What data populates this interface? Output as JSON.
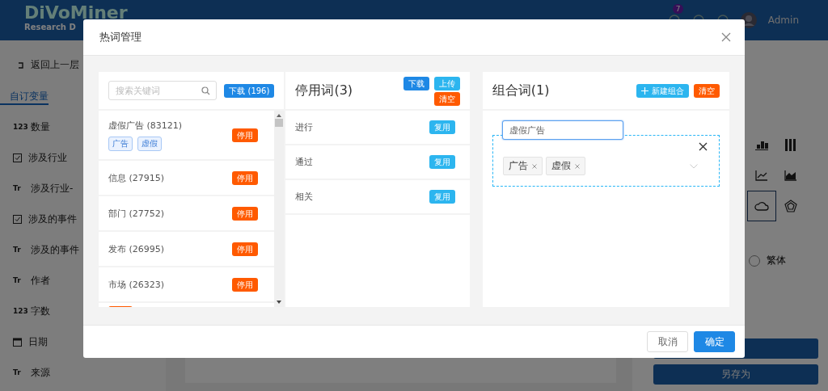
{
  "app": {
    "logo": "DiVoMiner",
    "logo_sub": "Research D",
    "notification_count": "7",
    "user": "Admin",
    "back": "返回上一层",
    "sidebar_tab": "自订变量",
    "variables": [
      {
        "kind": "number",
        "icon": "123",
        "label": "数量"
      },
      {
        "kind": "check",
        "label": "涉及行业"
      },
      {
        "kind": "text",
        "icon": "Tr",
        "label": "涉及行业-"
      },
      {
        "kind": "check",
        "label": "涉及的事件"
      },
      {
        "kind": "text",
        "icon": "Tr",
        "label": "涉及的事件"
      },
      {
        "kind": "text",
        "icon": "Tr",
        "label": "作者"
      },
      {
        "kind": "number",
        "icon": "123",
        "label": "字数"
      },
      {
        "kind": "date",
        "label": "日期"
      },
      {
        "kind": "text",
        "icon": "Tr",
        "label": "来源"
      }
    ],
    "chart_types": [
      {
        "kind": "stacked",
        "selected": false
      },
      {
        "kind": "columns",
        "selected": false
      },
      {
        "kind": "line",
        "selected": false
      },
      {
        "kind": "area",
        "selected": false
      },
      {
        "kind": "cloud",
        "selected": true
      },
      {
        "kind": "radar",
        "selected": false
      }
    ],
    "radio_option": {
      "label": "繁体",
      "selected": false
    },
    "save_as": "另存为"
  },
  "dialog": {
    "title": "热词管理",
    "hot_words": {
      "search": {
        "placeholder": "搜索关键词"
      },
      "download": "下载 (196)",
      "items": [
        {
          "word": "虚假广告 (83121)",
          "tags": [
            "广告",
            "虚假"
          ],
          "action": "停用"
        },
        {
          "word": "信息 (27915)",
          "action": "停用"
        },
        {
          "word": "部门 (27752)",
          "action": "停用"
        },
        {
          "word": "发布 (26995)",
          "action": "停用"
        },
        {
          "word": "市场 (26323)",
          "action": "停用"
        }
      ]
    },
    "stop_words": {
      "title": "停用词(3)",
      "download": "下载",
      "upload": "上传",
      "clear": "清空",
      "items": [
        {
          "word": "进行",
          "action": "复用"
        },
        {
          "word": "通过",
          "action": "复用"
        },
        {
          "word": "相关",
          "action": "复用"
        }
      ]
    },
    "combined_words": {
      "title": "组合词(1)",
      "new": "新建组合",
      "clear": "清空",
      "groups": [
        {
          "name": "虚假广告",
          "tags": [
            "广告",
            "虚假"
          ]
        }
      ]
    },
    "cancel": "取消",
    "ok": "确定"
  }
}
